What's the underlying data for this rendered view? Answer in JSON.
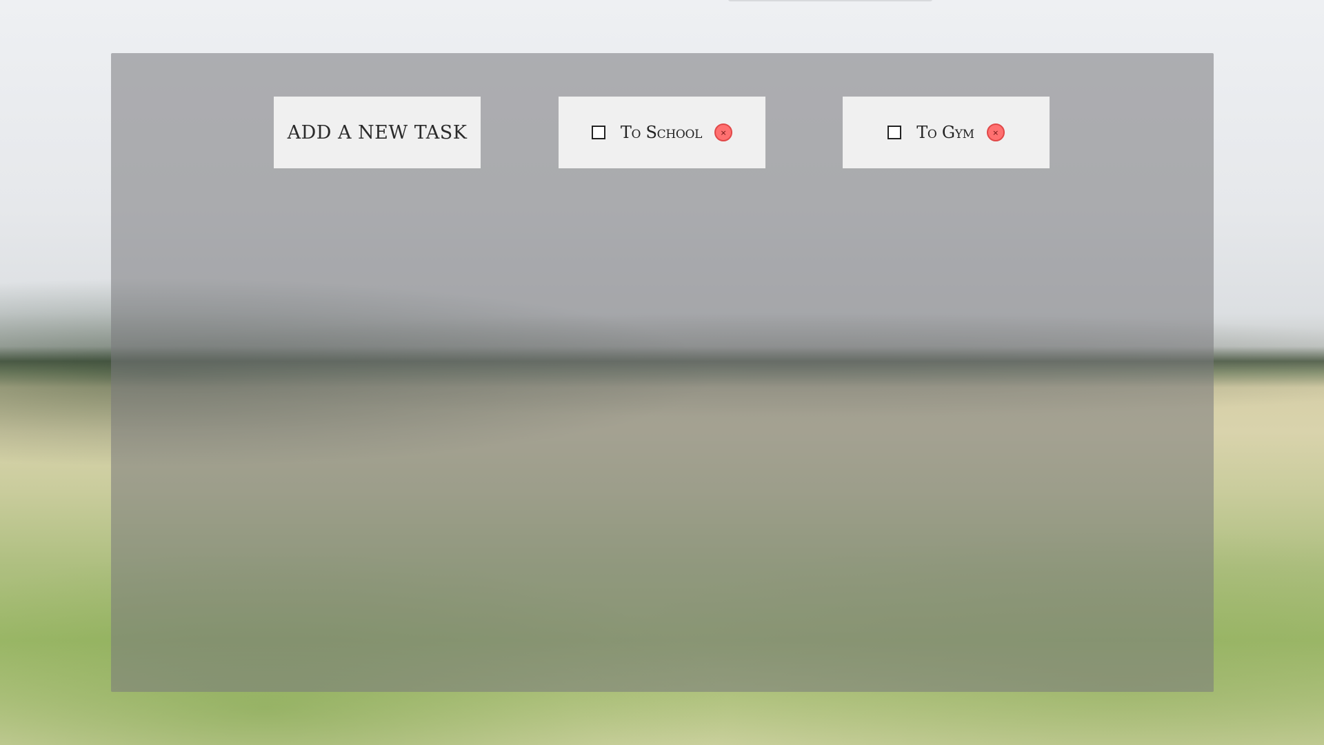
{
  "add_task": {
    "label": "Add a new task"
  },
  "tasks": [
    {
      "label": "To School",
      "checked": false,
      "delete_glyph": "×"
    },
    {
      "label": "To Gym",
      "checked": false,
      "delete_glyph": "×"
    }
  ],
  "colors": {
    "card_background": "#f0f0f0",
    "panel_overlay": "rgba(120,120,124,0.55)",
    "delete_button": "#ff7070",
    "delete_button_border": "#e04848"
  },
  "icons": {
    "checkbox": "checkbox-icon",
    "delete": "close-icon"
  }
}
